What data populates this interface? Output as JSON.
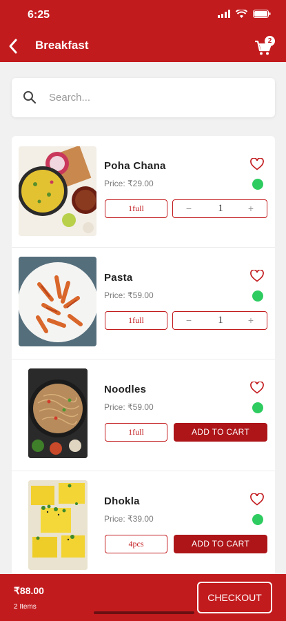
{
  "status_bar": {
    "time": "6:25"
  },
  "header": {
    "title": "Breakfast",
    "cart_count": "2"
  },
  "search": {
    "placeholder": "Search..."
  },
  "items": [
    {
      "name": "Poha Chana",
      "price": "Price: ₹29.00",
      "variant": "1full",
      "action": "stepper",
      "quantity": "1",
      "veg": true
    },
    {
      "name": "Pasta",
      "price": "Price: ₹59.00",
      "variant": "1full",
      "action": "stepper",
      "quantity": "1",
      "veg": true
    },
    {
      "name": "Noodles",
      "price": "Price: ₹59.00",
      "variant": "1full",
      "action": "add",
      "add_label": "ADD TO CART",
      "veg": true
    },
    {
      "name": "Dhokla",
      "price": "Price: ₹39.00",
      "variant": "4pcs",
      "action": "add",
      "add_label": "ADD TO CART",
      "veg": true
    }
  ],
  "stepper": {
    "minus": "−",
    "plus": "+"
  },
  "footer": {
    "total": "₹88.00",
    "items_count": "2 Items",
    "checkout_label": "CHECKOUT"
  },
  "colors": {
    "brand": "#c21b1e",
    "veg": "#2ecc60",
    "button": "#ad1518"
  },
  "icons": {
    "back": "chevron-left-icon",
    "cart": "cart-icon",
    "search": "search-icon",
    "favorite": "heart-icon"
  }
}
